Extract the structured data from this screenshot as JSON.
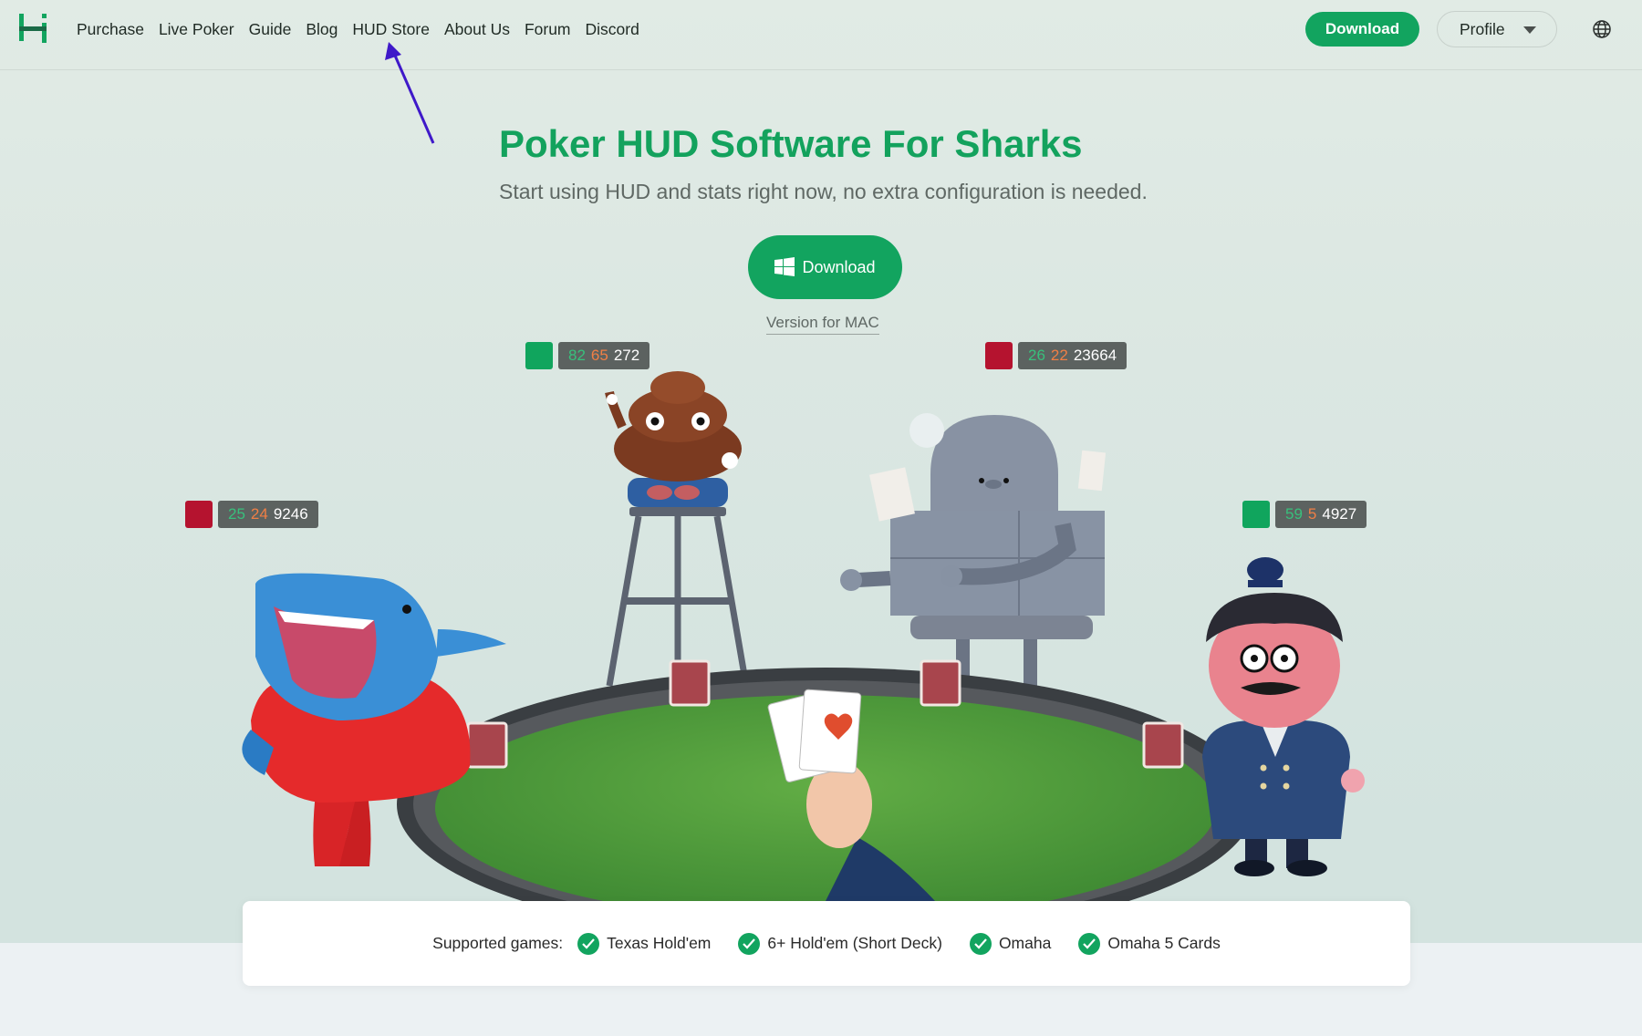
{
  "nav": {
    "items": [
      "Purchase",
      "Live Poker",
      "Guide",
      "Blog",
      "HUD Store",
      "About Us",
      "Forum",
      "Discord"
    ],
    "download_label": "Download",
    "profile_label": "Profile"
  },
  "hero": {
    "title": "Poker HUD Software For Sharks",
    "subtitle": "Start using HUD and stats right now, no extra configuration is needed.",
    "download_label": "Download",
    "mac_link": "Version for MAC"
  },
  "players": [
    {
      "color": "#10a55d",
      "v1": "82",
      "v2": "65",
      "v3": "272"
    },
    {
      "color": "#b5132f",
      "v1": "26",
      "v2": "22",
      "v3": "23664"
    },
    {
      "color": "#b5132f",
      "v1": "25",
      "v2": "24",
      "v3": "9246"
    },
    {
      "color": "#10a55d",
      "v1": "59",
      "v2": "5",
      "v3": "4927"
    }
  ],
  "games": {
    "label": "Supported games:",
    "items": [
      "Texas Hold'em",
      "6+ Hold'em (Short Deck)",
      "Omaha",
      "Omaha 5 Cards"
    ]
  },
  "colors": {
    "brand": "#12a45f",
    "table": "#4f9a3a",
    "annotation_arrow": "#3f19c9"
  }
}
